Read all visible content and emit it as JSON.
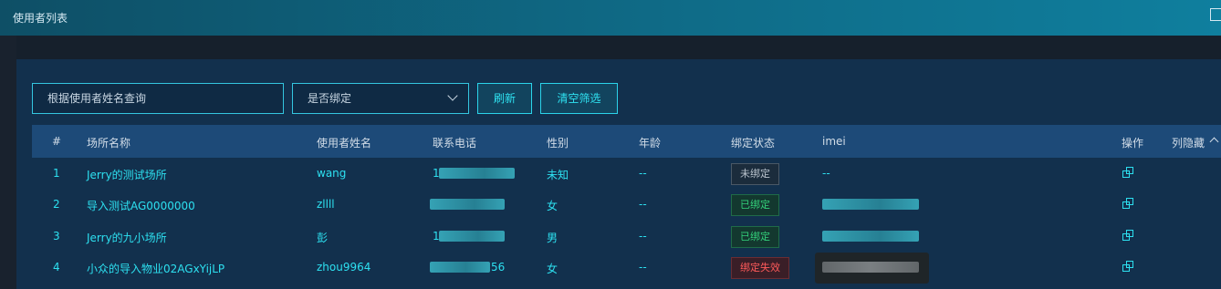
{
  "window": {
    "title": "使用者列表"
  },
  "filters": {
    "search_placeholder": "根据使用者姓名查询",
    "bind_select_value": "是否绑定",
    "refresh_label": "刷新",
    "clear_label": "清空筛选"
  },
  "table": {
    "headers": [
      "#",
      "场所名称",
      "使用者姓名",
      "联系电话",
      "性别",
      "年龄",
      "绑定状态",
      "imei",
      "操作",
      "列隐藏"
    ],
    "rows": [
      {
        "index": "1",
        "venue": "Jerry的测试场所",
        "user": "wang",
        "phone_visible": "1",
        "gender": "未知",
        "age": "--",
        "status": "未绑定",
        "imei": "--"
      },
      {
        "index": "2",
        "venue": "导入测试AG0000000",
        "user": "zllll",
        "phone_visible": "",
        "gender": "女",
        "age": "--",
        "status": "已绑定",
        "imei": ""
      },
      {
        "index": "3",
        "venue": "Jerry的九小场所",
        "user": "彭",
        "phone_visible": "1",
        "gender": "男",
        "age": "--",
        "status": "已绑定",
        "imei": ""
      },
      {
        "index": "4",
        "venue": "小众的导入物业02AGxYijLP",
        "user": "zhou9964",
        "phone_visible": "56",
        "gender": "女",
        "age": "--",
        "status": "绑定失效",
        "imei": ""
      }
    ]
  },
  "colors": {
    "accent": "#2de0f0",
    "header_bg": "#1d4a78",
    "panel_bg": "#12304d",
    "bound": "#33d07a",
    "failed": "#ff5a5a"
  },
  "icons": {
    "row_action": "copy-icon",
    "maximize": "maximize-icon",
    "collapse": "chevron-up-icon"
  }
}
